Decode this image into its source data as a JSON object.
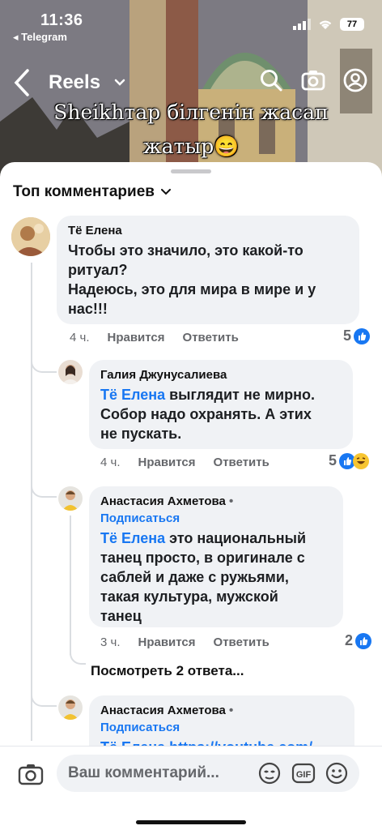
{
  "status_bar": {
    "time": "11:36",
    "back_app": "◂ Telegram",
    "battery": "77"
  },
  "reels": {
    "title": "Reels",
    "overlay_line1": "Sheikhтар білгенін жасап",
    "overlay_line2": "жатыр😄"
  },
  "sheet": {
    "title": "Топ комментариев"
  },
  "comments": [
    {
      "author": "Тё Елена",
      "text_lines": [
        "Чтобы это значило, это какой-то",
        "ритуал?",
        "Надеюсь, это для мира в мире и у",
        "нас!!!"
      ],
      "time": "4 ч.",
      "like": "Нравится",
      "reply": "Ответить",
      "reactions": "5"
    },
    {
      "author": "Галия Джунусалиева",
      "mention": "Тё Елена",
      "text_first": " выглядит не мирно.",
      "text_lines": [
        "Собор надо охранять. А этих",
        "не пускать."
      ],
      "time": "4 ч.",
      "like": "Нравится",
      "reply": "Ответить",
      "reactions": "5"
    },
    {
      "author": "Анастасия Ахметова",
      "follow": "Подписаться",
      "mention": "Тё Елена",
      "text_first": " это национальный",
      "text_lines": [
        "танец просто, в оригинале с",
        "саблей и даже с ружьями,",
        "такая культура, мужской",
        "танец"
      ],
      "time": "3 ч.",
      "like": "Нравится",
      "reply": "Ответить",
      "reactions": "2",
      "view_replies": "Посмотреть 2 ответа..."
    },
    {
      "author": "Анастасия Ахметова",
      "follow": "Подписаться",
      "text_partial": "Тё Елена https://youtube.com/"
    }
  ],
  "input": {
    "placeholder": "Ваш комментарий..."
  },
  "colors": {
    "accent": "#1877f2",
    "bubble": "#f0f2f5",
    "meta": "#65676b"
  }
}
